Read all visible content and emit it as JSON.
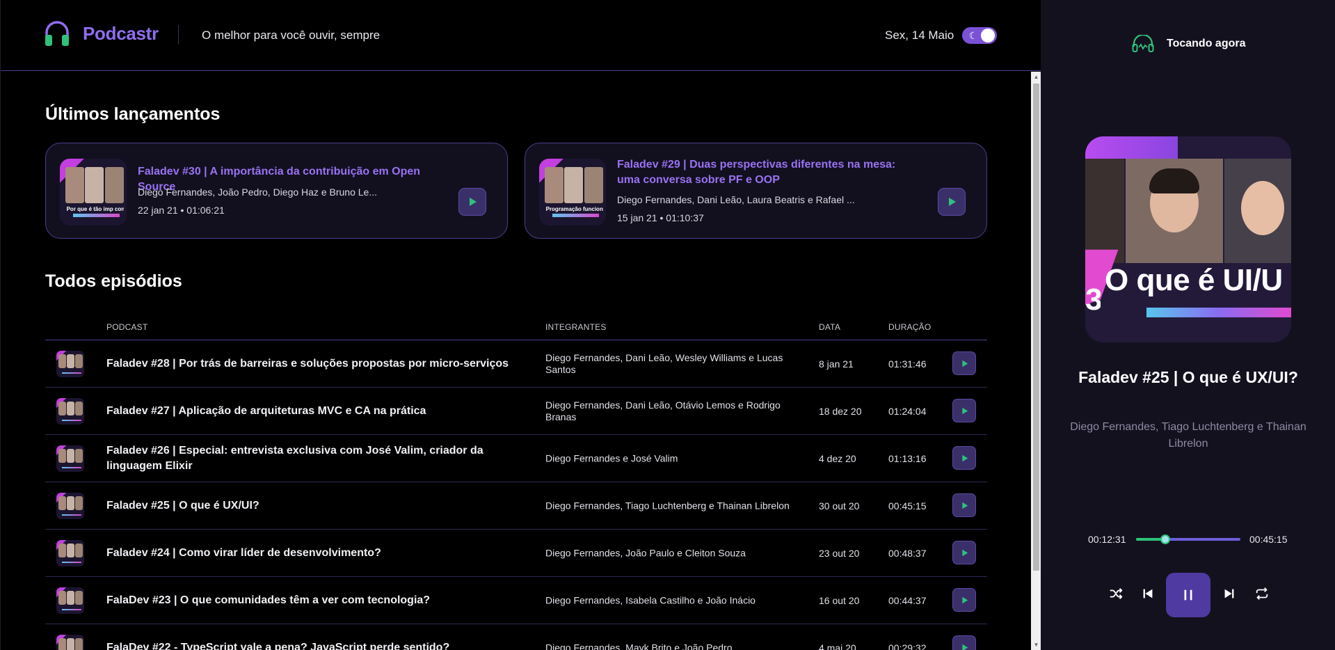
{
  "header": {
    "brand": "Podcastr",
    "tagline": "O melhor para você ouvir, sempre",
    "date": "Sex, 14 Maio",
    "theme_toggle": "dark"
  },
  "latest": {
    "title": "Últimos lançamentos",
    "cards": [
      {
        "title": "Faladev #30 | A importância da contribuição em Open Source",
        "members": "Diego Fernandes, João Pedro, Diego Haz e Bruno Le...",
        "meta": "22 jan 21 • 01:06:21",
        "thumb_text": "Por que é tão imp contribuir em Open S"
      },
      {
        "title": "Faladev #29 | Duas perspectivas diferentes na mesa: uma conversa sobre PF e OOP",
        "members": "Diego Fernandes, Dani Leão, Laura Beatris e Rafael ...",
        "meta": "15 jan 21 • 01:10:37",
        "thumb_text": "Programação funciona devs orientados a o"
      }
    ]
  },
  "all": {
    "title": "Todos episódios",
    "columns": {
      "podcast": "PODCAST",
      "members": "INTEGRANTES",
      "date": "DATA",
      "duration": "DURAÇÃO"
    },
    "rows": [
      {
        "title": "Faladev #28 | Por trás de barreiras e soluções propostas por micro-serviços",
        "members": "Diego Fernandes, Dani Leão, Wesley Williams e Lucas Santos",
        "date": "8 jan 21",
        "duration": "01:31:46"
      },
      {
        "title": "Faladev #27 | Aplicação de arquiteturas MVC e CA na prática",
        "members": "Diego Fernandes, Dani Leão, Otávio Lemos e Rodrigo Branas",
        "date": "18 dez 20",
        "duration": "01:24:04"
      },
      {
        "title": "Faladev #26 | Especial: entrevista exclusiva com José Valim, criador da linguagem Elixir",
        "members": "Diego Fernandes e José Valim",
        "date": "4 dez 20",
        "duration": "01:13:16"
      },
      {
        "title": "Faladev #25 | O que é UX/UI?",
        "members": "Diego Fernandes, Tiago Luchtenberg e Thainan Librelon",
        "date": "30 out 20",
        "duration": "00:45:15"
      },
      {
        "title": "Faladev #24 | Como virar líder de desenvolvimento?",
        "members": "Diego Fernandes, João Paulo e Cleiton Souza",
        "date": "23 out 20",
        "duration": "00:48:37"
      },
      {
        "title": "FalaDev #23 | O que comunidades têm a ver com tecnologia?",
        "members": "Diego Fernandes, Isabela Castilho e João Inácio",
        "date": "16 out 20",
        "duration": "00:44:37"
      },
      {
        "title": "FalaDev #22 - TypeScript vale a pena? JavaScript perde sentido?",
        "members": "Diego Fernandes, Mayk Brito e João Pedro",
        "date": "4 mai 20",
        "duration": "00:29:32"
      }
    ]
  },
  "player": {
    "heading": "Tocando agora",
    "cover_text": "O que é UI/U",
    "cover_number": "3",
    "title": "Faladev #25 | O que é UX/UI?",
    "members": "Diego Fernandes, Tiago Luchtenberg e Thainan Librelon",
    "current_time": "00:12:31",
    "total_time": "00:45:15",
    "progress": 0.277,
    "state": "playing"
  },
  "colors": {
    "accent": "#8f6ef0",
    "play_icon": "#2ec27a",
    "border": "#4b3f8a",
    "player_bg": "#14111f"
  },
  "icons": {
    "logo": "headphones-icon",
    "toggle": "moon-icon",
    "play": "play-icon",
    "shuffle": "shuffle-icon",
    "previous": "skip-previous-icon",
    "pause": "pause-icon",
    "next": "skip-next-icon",
    "repeat": "repeat-icon"
  }
}
